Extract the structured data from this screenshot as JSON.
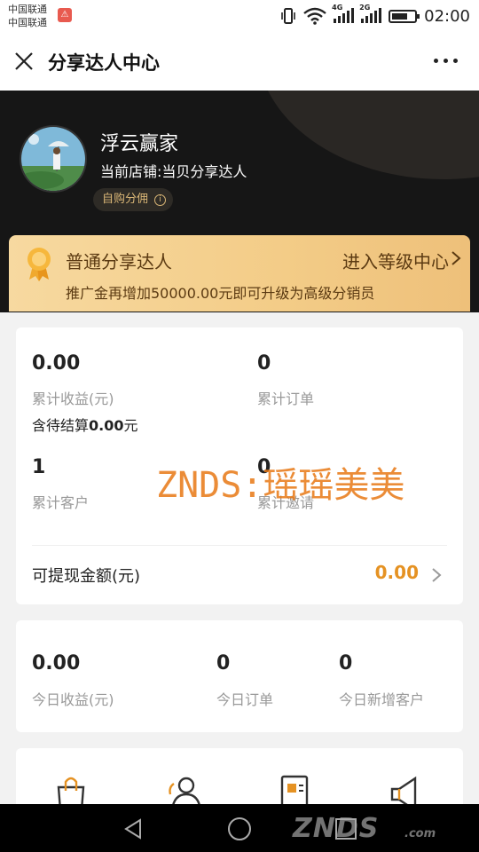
{
  "status_bar": {
    "carrier_line1": "中国联通",
    "carrier_line2": "中国联通",
    "carrier_badge": "⚠",
    "net1": "4G",
    "net2": "2G",
    "battery_level": 0.7,
    "time": "02:00"
  },
  "title_bar": {
    "title": "分享达人中心",
    "close_icon": "close-icon",
    "more_icon": "more-icon"
  },
  "profile": {
    "name": "浮云赢家",
    "shop": "当前店铺:当贝分享达人",
    "tag": "自购分佣",
    "tag_info": "i"
  },
  "level": {
    "name": "普通分享达人",
    "link": "进入等级中心",
    "hint": "推广金再增加50000.00元即可升级为高级分销员",
    "colors": {
      "text": "#5b3a12",
      "bg": "#f3cc87"
    }
  },
  "stats": {
    "total_income_value": "0.00",
    "total_income_label": "累计收益(元)",
    "pending_prefix": "含待结算",
    "pending_value": "0.00",
    "pending_suffix": "元",
    "total_orders_value": "0",
    "total_orders_label": "累计订单",
    "total_customers_value": "1",
    "total_customers_label": "累计客户",
    "total_invites_value": "0",
    "total_invites_label": "累计邀请",
    "withdraw_label": "可提现金额(元)",
    "withdraw_value": "0.00"
  },
  "today": {
    "income_value": "0.00",
    "income_label": "今日收益(元)",
    "orders_value": "0",
    "orders_label": "今日订单",
    "new_customers_value": "0",
    "new_customers_label": "今日新增客户"
  },
  "tools": [
    "bag-icon",
    "person-icon",
    "document-icon",
    "speaker-icon"
  ],
  "watermark": "ZNDS:瑶瑶美美",
  "nav_watermark": {
    "logo": "ZNDS",
    "suffix": ".com"
  },
  "accent_color": "#e59223"
}
